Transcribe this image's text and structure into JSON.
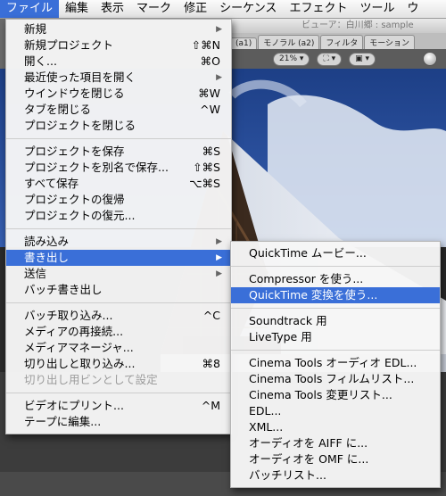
{
  "menubar": {
    "items": [
      {
        "label": "ファイル"
      },
      {
        "label": "編集"
      },
      {
        "label": "表示"
      },
      {
        "label": "マーク"
      },
      {
        "label": "修正"
      },
      {
        "label": "シーケンス"
      },
      {
        "label": "エフェクト"
      },
      {
        "label": "ツール"
      },
      {
        "label": "ウ"
      }
    ]
  },
  "background": {
    "viewer_title": "ビューア：白川郷 : sample",
    "tabs": [
      "(a1)",
      "モノラル (a2)",
      "フィルタ",
      "モーション"
    ],
    "zoom": "21%"
  },
  "file_menu": {
    "group1": [
      {
        "label": "新規",
        "shortcut": "",
        "submenu": true
      },
      {
        "label": "新規プロジェクト",
        "shortcut": "⇧⌘N"
      },
      {
        "label": "開く...",
        "shortcut": "⌘O"
      },
      {
        "label": "最近使った項目を開く",
        "shortcut": "",
        "submenu": true
      },
      {
        "label": "ウインドウを閉じる",
        "shortcut": "⌘W"
      },
      {
        "label": "タブを閉じる",
        "shortcut": "^W"
      },
      {
        "label": "プロジェクトを閉じる",
        "shortcut": ""
      }
    ],
    "group2": [
      {
        "label": "プロジェクトを保存",
        "shortcut": "⌘S"
      },
      {
        "label": "プロジェクトを別名で保存...",
        "shortcut": "⇧⌘S"
      },
      {
        "label": "すべて保存",
        "shortcut": "⌥⌘S"
      },
      {
        "label": "プロジェクトの復帰",
        "shortcut": ""
      },
      {
        "label": "プロジェクトの復元...",
        "shortcut": ""
      }
    ],
    "group3": [
      {
        "label": "読み込み",
        "shortcut": "",
        "submenu": true
      },
      {
        "label": "書き出し",
        "shortcut": "",
        "submenu": true
      },
      {
        "label": "送信",
        "shortcut": "",
        "submenu": true
      },
      {
        "label": "バッチ書き出し",
        "shortcut": ""
      }
    ],
    "group4": [
      {
        "label": "バッチ取り込み...",
        "shortcut": "^C"
      },
      {
        "label": "メディアの再接続...",
        "shortcut": ""
      },
      {
        "label": "メディアマネージャ...",
        "shortcut": ""
      },
      {
        "label": "切り出しと取り込み...",
        "shortcut": "⌘8"
      },
      {
        "label": "切り出し用ビンとして設定",
        "shortcut": ""
      }
    ],
    "group5": [
      {
        "label": "ビデオにプリント...",
        "shortcut": "^M"
      },
      {
        "label": "テープに編集...",
        "shortcut": ""
      }
    ]
  },
  "export_menu": {
    "group1": [
      {
        "label": "QuickTime ムービー..."
      }
    ],
    "group2": [
      {
        "label": "Compressor を使う..."
      },
      {
        "label": "QuickTime 変換を使う..."
      }
    ],
    "group3": [
      {
        "label": "Soundtrack 用"
      },
      {
        "label": "LiveType 用"
      }
    ],
    "group4": [
      {
        "label": "Cinema Tools オーディオ EDL..."
      },
      {
        "label": "Cinema Tools フィルムリスト..."
      },
      {
        "label": "Cinema Tools 変更リスト..."
      },
      {
        "label": "EDL..."
      },
      {
        "label": "XML..."
      },
      {
        "label": "オーディオを AIFF に..."
      },
      {
        "label": "オーディオを OMF に..."
      },
      {
        "label": "バッチリスト..."
      }
    ]
  },
  "colors": {
    "selection": "#3a6fd8"
  }
}
